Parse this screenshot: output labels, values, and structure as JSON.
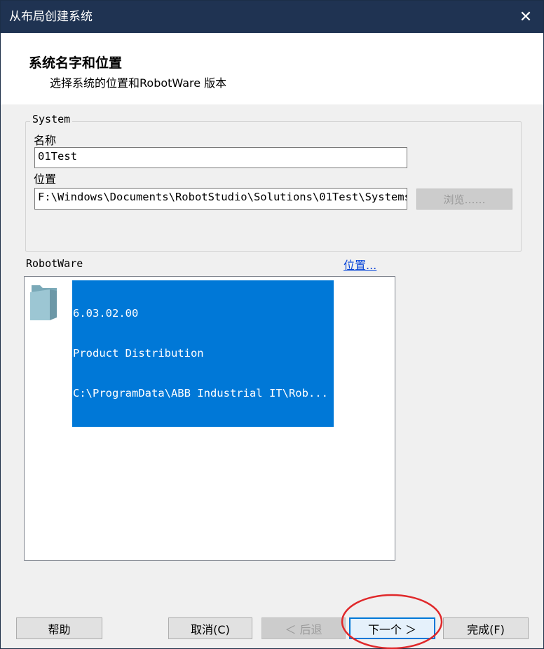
{
  "window": {
    "title": "从布局创建系统",
    "close_glyph": "✕"
  },
  "header": {
    "title": "系统名字和位置",
    "subtitle": "选择系统的位置和RobotWare 版本"
  },
  "system": {
    "legend": "System",
    "name_label": "名称",
    "name_value": "01Test",
    "location_label": "位置",
    "location_value": "F:\\Windows\\Documents\\RobotStudio\\Solutions\\01Test\\Systems",
    "browse_label": "浏览……"
  },
  "robotware": {
    "label": "RobotWare",
    "location_link": "位置...",
    "items": [
      {
        "version": "6.03.02.00",
        "distribution": "Product Distribution",
        "path": "C:\\ProgramData\\ABB Industrial IT\\Rob...",
        "icon": "folder-icon",
        "selected": true
      }
    ]
  },
  "buttons": {
    "help": "帮助",
    "cancel": "取消(C)",
    "back": "＜ 后退",
    "next": "下一个 ＞",
    "finish": "完成(F)"
  },
  "colors": {
    "titlebar": "#1f3352",
    "selection": "#0078d7",
    "link": "#0645d8",
    "annotation": "#e0282a"
  }
}
